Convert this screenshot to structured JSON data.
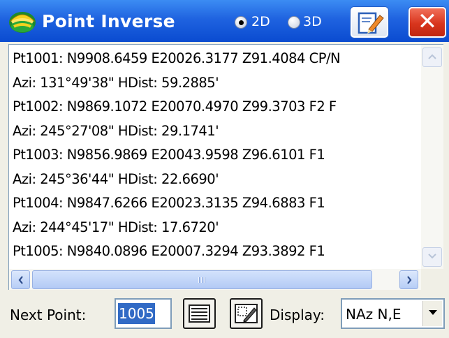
{
  "window": {
    "title": "Point Inverse",
    "app_icon": "carlson-helmet-icon",
    "mode_options": [
      {
        "label": "2D",
        "selected": true
      },
      {
        "label": "3D",
        "selected": false
      }
    ],
    "edit_icon": "edit-notes-icon",
    "close_label": "✕"
  },
  "results": {
    "lines": [
      "Pt1001: N9908.6459 E20026.3177 Z91.4084 CP/N",
      "Azi: 131°49'38\"   HDist: 59.2885'",
      "Pt1002: N9869.1072 E20070.4970 Z99.3703 F2 F",
      "Azi: 245°27'08\"   HDist: 29.1741'",
      "Pt1003: N9856.9869 E20043.9598 Z96.6101 F1",
      "Azi: 245°36'44\"   HDist: 22.6690'",
      "Pt1004: N9847.6266 E20023.3135 Z94.6883 F1",
      "Azi: 244°45'17\"   HDist: 17.6720'",
      "Pt1005: N9840.0896 E20007.3294 Z93.3892 F1"
    ]
  },
  "bottom": {
    "next_point_label": "Next Point:",
    "next_point_value": "1005",
    "list_icon": "list-lines-icon",
    "map_icon": "map-select-icon",
    "display_label": "Display:",
    "display_value": "NAz N,E"
  },
  "colors": {
    "titlebar": "#1f63e0",
    "close": "#d8351d",
    "selection": "#316ac5"
  }
}
